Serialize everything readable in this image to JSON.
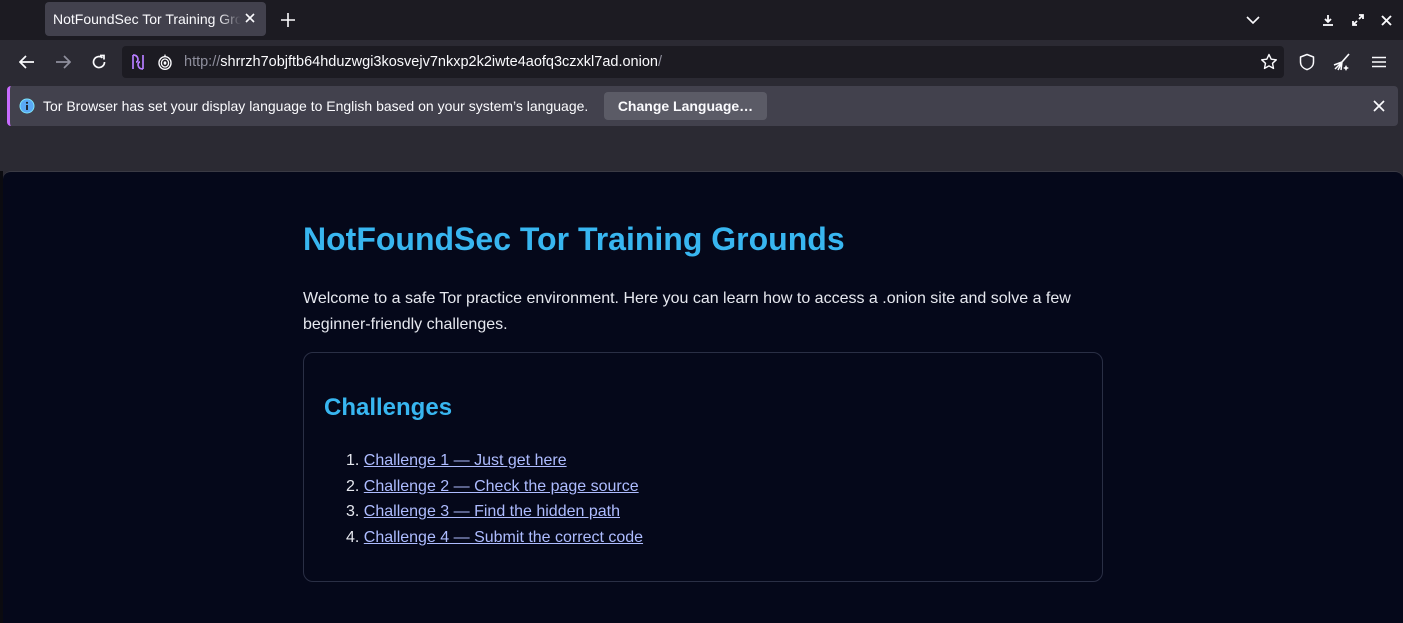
{
  "tab": {
    "title": "NotFoundSec Tor Training Grounds"
  },
  "urlbar": {
    "scheme": "http://",
    "host": "shrrzh7objftb64hduzwgi3kosvejv7nkxp2k2iwte4aofq3czxkl7ad.onion",
    "path": "/"
  },
  "notification": {
    "message": "Tor Browser has set your display language to English based on your system’s language.",
    "button_label": "Change Language…"
  },
  "page": {
    "title": "NotFoundSec Tor Training Grounds",
    "intro": "Welcome to a safe Tor practice environment. Here you can learn how to access a .onion site and solve a few beginner-friendly challenges.",
    "challenges_title": "Challenges",
    "challenges": [
      {
        "number": "1.",
        "label": "Challenge 1 — Just get here"
      },
      {
        "number": "2.",
        "label": "Challenge 2 — Check the page source"
      },
      {
        "number": "3.",
        "label": "Challenge 3 — Find the hidden path"
      },
      {
        "number": "4.",
        "label": "Challenge 4 — Submit the correct code"
      }
    ]
  },
  "colors": {
    "accent_heading": "#38b6f0",
    "link": "#aebcff",
    "page_bg": "#05081a"
  },
  "icons": [
    "close-icon",
    "plus-icon",
    "chevron-down-icon",
    "download-icon",
    "fullscreen-icon",
    "back-icon",
    "forward-icon",
    "reload-icon",
    "tor-circuit-icon",
    "onion-icon",
    "star-icon",
    "shield-icon",
    "broom-icon",
    "menu-icon",
    "info-icon"
  ]
}
